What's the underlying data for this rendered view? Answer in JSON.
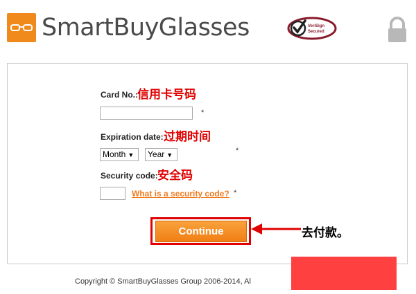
{
  "header": {
    "brand": "SmartBuyGlasses",
    "verisign_text": "VeriSign Secured"
  },
  "form": {
    "card_no": {
      "label": "Card No.:",
      "annotation": "信用卡号码",
      "required": "*"
    },
    "expiration": {
      "label": "Expiration date:",
      "annotation": "过期时间",
      "month_value": "Month",
      "year_value": "Year",
      "required": "*"
    },
    "security": {
      "label": "Security code:",
      "annotation": "安全码",
      "help_link": "What is a security code?",
      "required": "*"
    },
    "continue_label": "Continue",
    "continue_annotation": "去付款。"
  },
  "footer": {
    "copyright": "Copyright © SmartBuyGlasses Group 2006-2014, Al"
  },
  "colors": {
    "brand_orange": "#f08a1c",
    "annotation_red": "#e00000",
    "redaction": "#ff4040"
  },
  "icons": [
    "glasses-logo-icon",
    "verisign-check-icon",
    "lock-icon",
    "red-arrow-icon"
  ]
}
